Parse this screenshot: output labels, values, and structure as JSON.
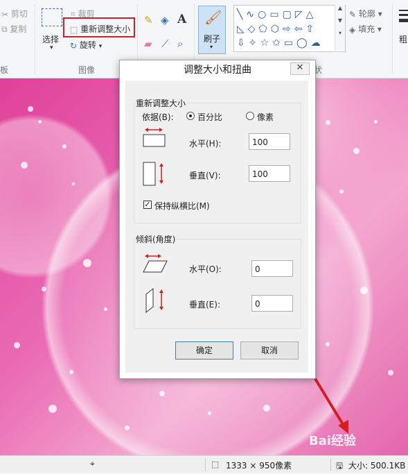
{
  "ribbon": {
    "clipboard": {
      "cut_label": "剪切",
      "copy_label": "复制",
      "group_label": "板"
    },
    "image": {
      "select_label": "选择",
      "crop_label": "裁剪",
      "resize_label": "重新调整大小",
      "rotate_label": "旋转",
      "group_label": "图像"
    },
    "tools": {
      "text_glyph": "A"
    },
    "brush": {
      "label": "刷子"
    },
    "shapes": {
      "outline_label": "轮廓",
      "fill_label": "填充",
      "group_tail": "状"
    },
    "size": {
      "label": "粗"
    }
  },
  "dialog": {
    "title": "调整大小和扭曲",
    "close_glyph": "✕",
    "resize": {
      "legend": "重新调整大小",
      "by_label": "依据(B):",
      "percent_label": "百分比",
      "pixels_label": "像素",
      "selected": "percent",
      "horizontal_label": "水平(H):",
      "horizontal_value": "100",
      "vertical_label": "垂直(V):",
      "vertical_value": "100",
      "keep_ratio_label": "保持纵横比(M)",
      "keep_ratio_checked": true
    },
    "skew": {
      "legend": "倾斜(角度)",
      "horizontal_label": "水平(O):",
      "horizontal_value": "0",
      "vertical_label": "垂直(E):",
      "vertical_value": "0"
    },
    "ok_label": "确定",
    "cancel_label": "取消"
  },
  "status": {
    "dimensions": "1333 × 950像素",
    "size": "大小: 500.1KB"
  },
  "watermark": "Bai经验",
  "colors": {
    "highlight": "#d31e25",
    "accent_blue": "#3c7fb1"
  }
}
